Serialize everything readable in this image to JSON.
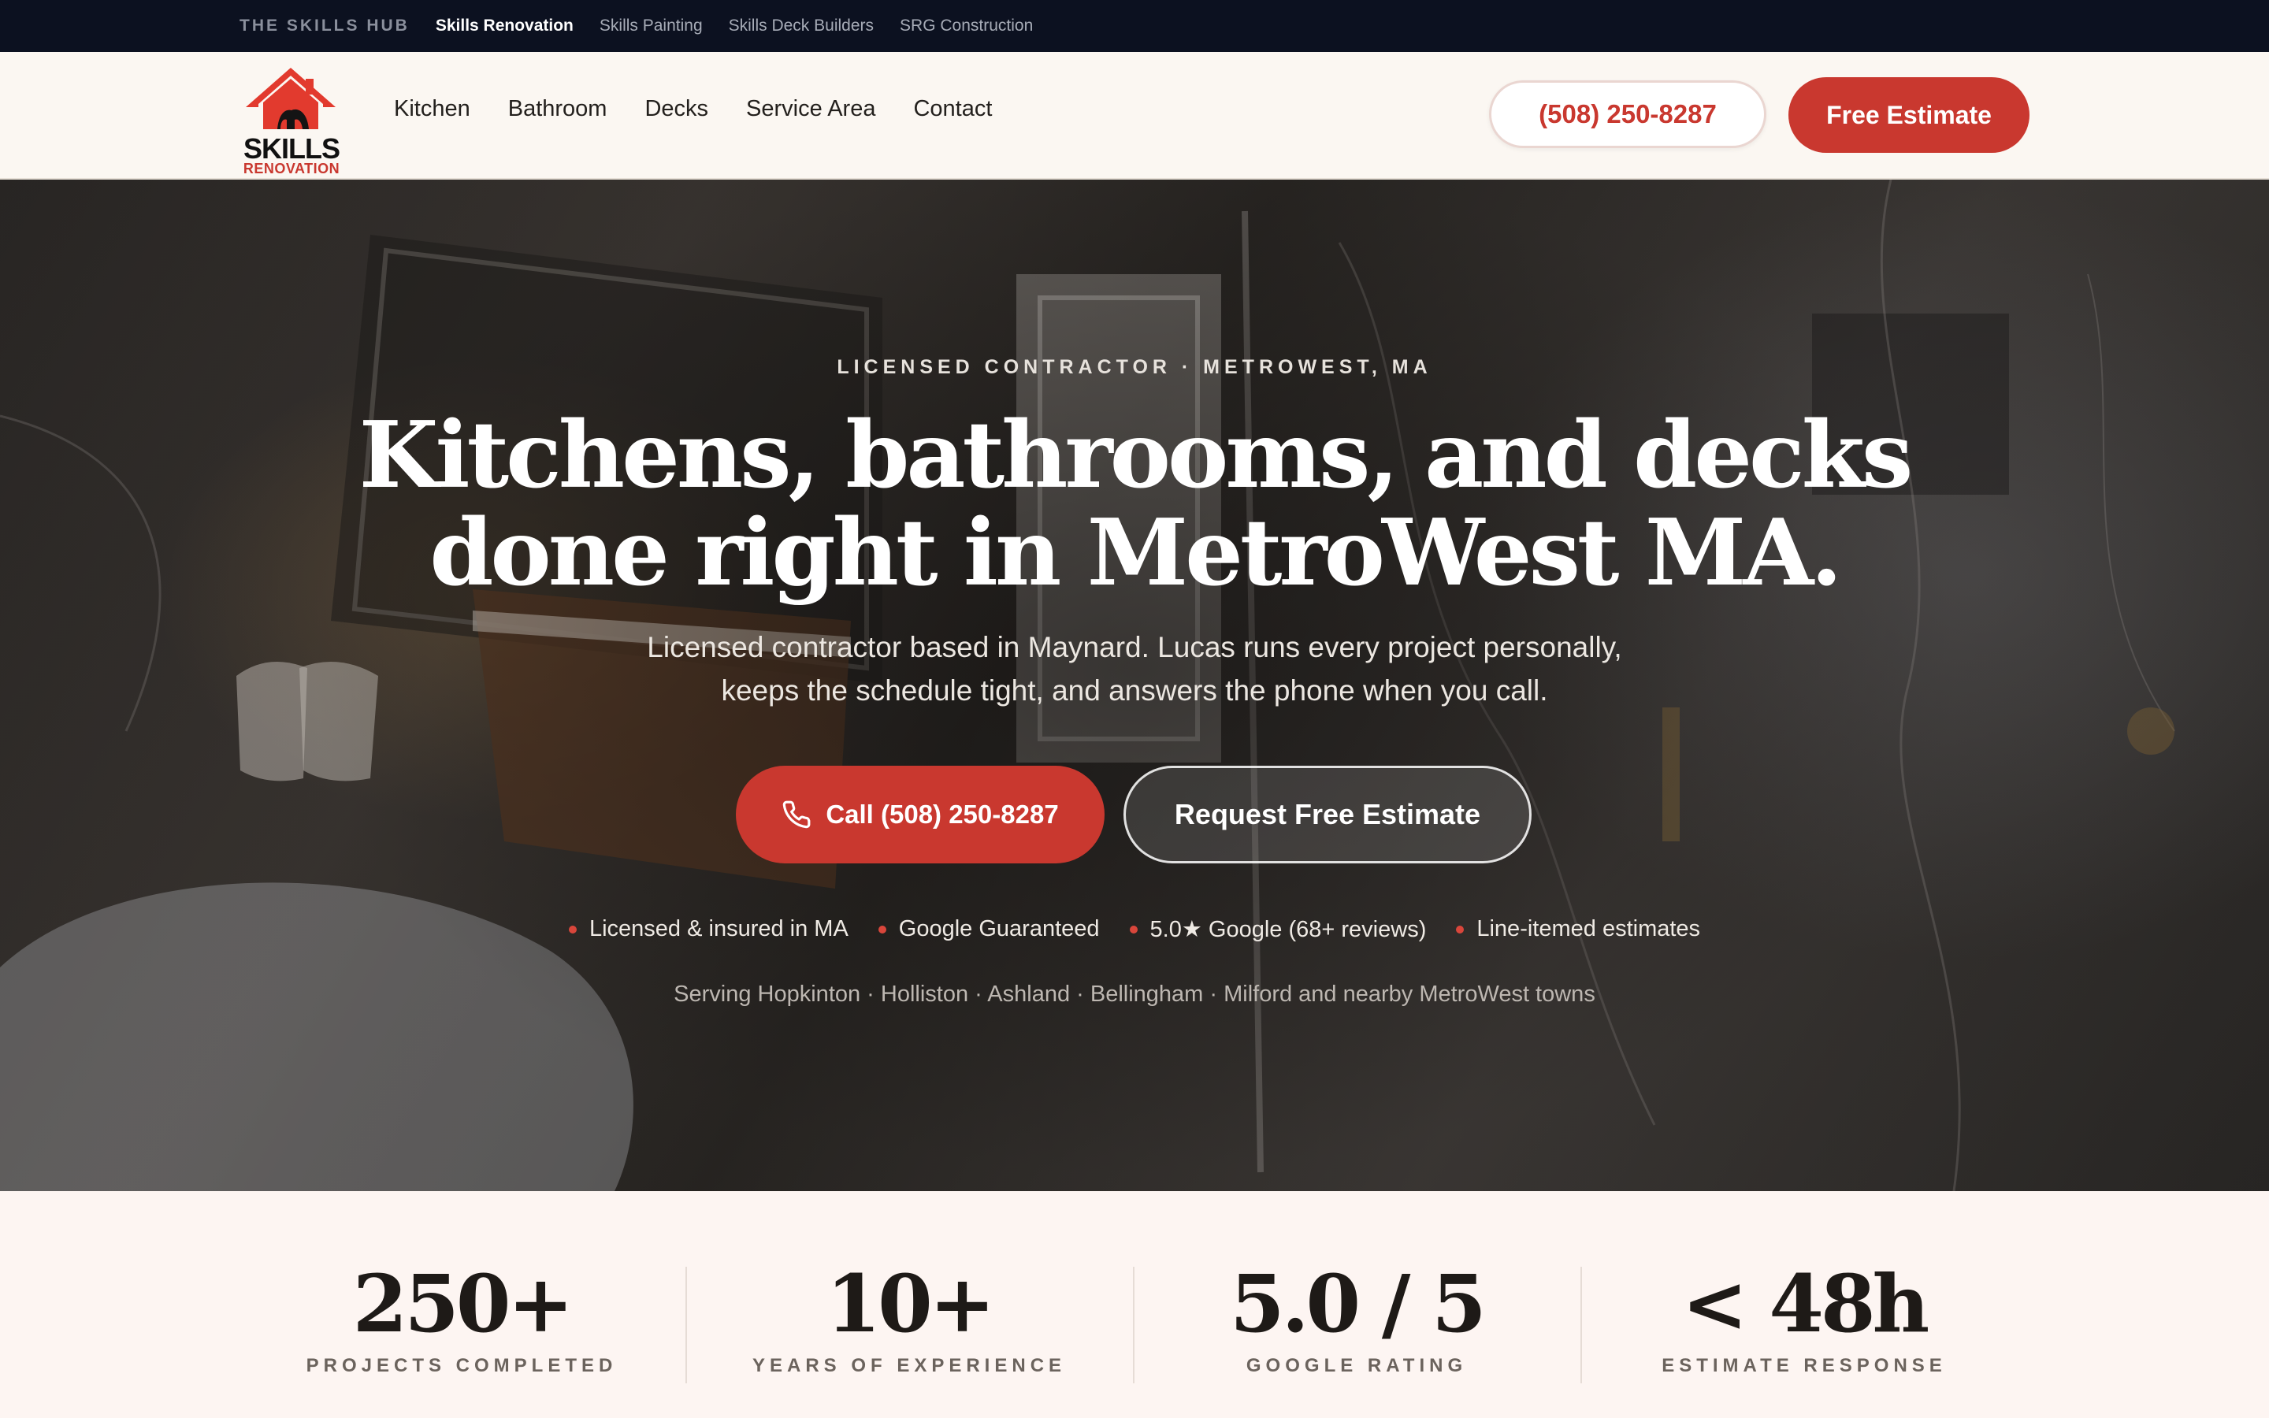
{
  "hub": {
    "title": "THE SKILLS HUB",
    "links": [
      "Skills Renovation",
      "Skills Painting",
      "Skills Deck Builders",
      "SRG Construction"
    ]
  },
  "header": {
    "logo_line1": "SKILLS",
    "logo_line2": "RENOVATION",
    "nav": [
      "Kitchen",
      "Bathroom",
      "Decks",
      "Service Area",
      "Contact"
    ],
    "phone": "(508) 250-8287",
    "cta": "Free Estimate"
  },
  "hero": {
    "eyebrow": "LICENSED CONTRACTOR · METROWEST, MA",
    "headline_line1": "Kitchens, bathrooms, and decks",
    "headline_line2": "done right in MetroWest MA.",
    "subhead_line1": "Licensed contractor based in Maynard. Lucas runs every project personally,",
    "subhead_line2": "keeps the schedule tight, and answers the phone when you call.",
    "call_button": "Call (508) 250-8287",
    "request_button": "Request Free Estimate",
    "trust": [
      "Licensed & insured in MA",
      "Google Guaranteed",
      "5.0★ Google (68+ reviews)",
      "Line-itemed estimates"
    ],
    "serving": "Serving Hopkinton · Holliston · Ashland · Bellingham · Milford and nearby MetroWest towns"
  },
  "stats": [
    {
      "value": "250+",
      "label": "PROJECTS COMPLETED"
    },
    {
      "value": "10+",
      "label": "YEARS OF EXPERIENCE"
    },
    {
      "value": "5.0 / 5",
      "label": "GOOGLE RATING"
    },
    {
      "value": "< 48h",
      "label": "ESTIMATE RESPONSE"
    }
  ],
  "colors": {
    "accent": "#c9382f",
    "hub_bar": "#0c1120",
    "header_bg": "#fbf7f2",
    "stats_bg": "#fdf5f2"
  },
  "icons": {
    "logo": "house-roof-icon",
    "call": "phone-icon",
    "trust_marker": "red-dot-icon"
  }
}
